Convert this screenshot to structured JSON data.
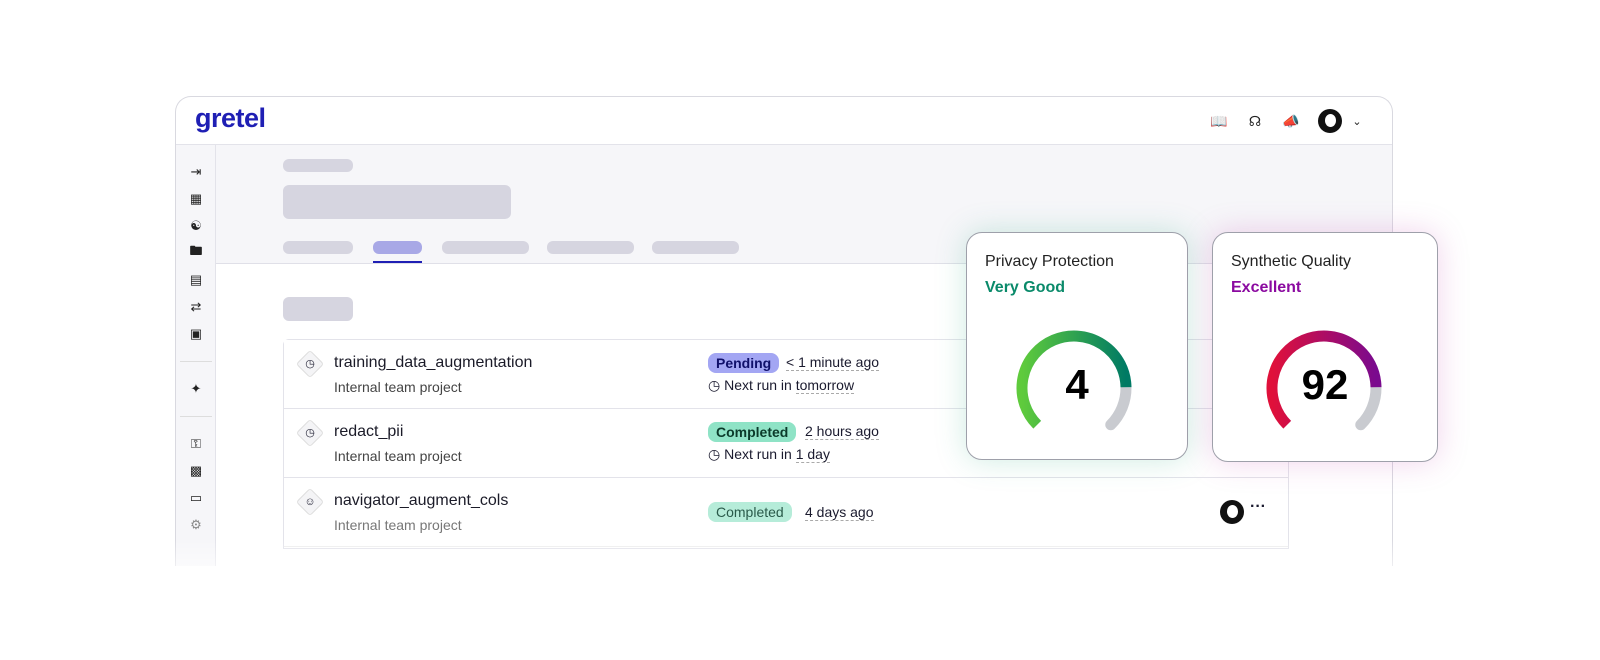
{
  "app": {
    "logo": "gretel"
  },
  "header": {
    "icons": [
      "book-icon",
      "headset-icon",
      "megaphone-icon",
      "avatar",
      "chevron-down-icon"
    ]
  },
  "sidebar": {
    "icons": [
      "collapse-icon",
      "grid-icon",
      "activity-icon",
      "folder-icon",
      "notebook-icon",
      "workflow-icon",
      "monitor-icon",
      "magic-wand-icon",
      "key-icon",
      "chart-icon",
      "card-icon",
      "gear-icon"
    ]
  },
  "rows": [
    {
      "name": "training_data_augmentation",
      "sub": "Internal team project",
      "status": "Pending",
      "when": "< 1 minute ago",
      "next_label": "Next run in",
      "next": "tomorrow",
      "icon": "clock-icon"
    },
    {
      "name": "redact_pii",
      "sub": "Internal team project",
      "status": "Completed",
      "when": "2 hours ago",
      "next_label": "Next run in",
      "next": "1 day",
      "icon": "clock-icon"
    },
    {
      "name": "navigator_augment_cols",
      "sub": "Internal team project",
      "status": "Completed",
      "when": "4 days ago",
      "icon": "user-icon"
    }
  ],
  "colors": {
    "brand": "#1f1fb4",
    "pending_bg": "#a3a6f3",
    "completed_bg": "#8fe3c6"
  },
  "cards": [
    {
      "title": "Privacy Protection",
      "rating": "Very Good",
      "value": "4",
      "fraction": 0.83,
      "rating_color": "#0a8a6a",
      "grad": [
        "#5fcb3c",
        "#007a64"
      ]
    },
    {
      "title": "Synthetic Quality",
      "rating": "Excellent",
      "value": "92",
      "fraction": 0.83,
      "rating_color": "#8b0aa0",
      "grad": [
        "#e0103a",
        "#7a0a8e"
      ]
    }
  ]
}
